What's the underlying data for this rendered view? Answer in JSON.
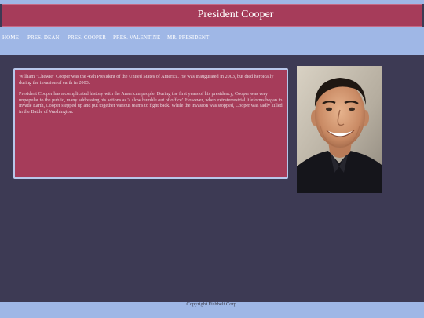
{
  "header": {
    "title": "President Cooper"
  },
  "nav": {
    "items": [
      {
        "label": "HOME"
      },
      {
        "label": "PRES. DEAN"
      },
      {
        "label": "PRES. COOPER"
      },
      {
        "label": "PRES. VALENTINE"
      },
      {
        "label": "MR. PRESIDENT"
      }
    ]
  },
  "main": {
    "paragraphs": [
      "William \"Chewie\" Cooper was the 45th President of the United States of America. He was inaugurated in 2003, but died heroically during the invasion of earth in 2003.",
      "President Cooper has a complicated history with the American people. During the first years of his presidency, Cooper was very unpopular to the public, many addressing his actions as 'a slow bumble out of office'. However, when extraterrestrial lifeforms began to invade Earth, Cooper stepped up and put together various teams to fight back. While the invasion was stopped, Cooper was sadly killed in the Battle of Washington."
    ]
  },
  "footer": {
    "text": "Copyright Fishbelt Corp."
  },
  "colors": {
    "page_background": "#3d3a54",
    "nav_background": "#9fb7e6",
    "title_background": "#a63c5a",
    "content_background": "#a63c5a"
  }
}
